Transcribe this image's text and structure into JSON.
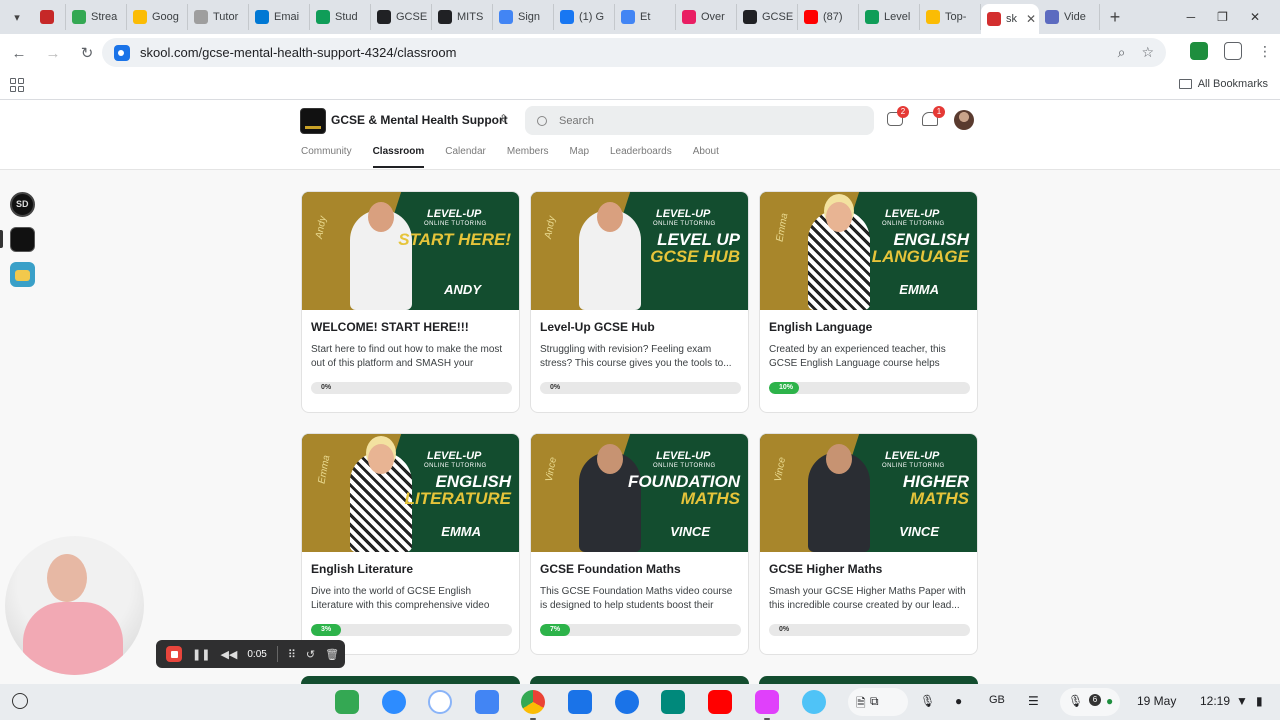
{
  "browser": {
    "tabs": [
      {
        "label": "",
        "color": "#c62828"
      },
      {
        "label": "Strea",
        "color": "#34a853"
      },
      {
        "label": "Goog",
        "color": "#fbbc04"
      },
      {
        "label": "Tutor",
        "color": "#9e9e9e"
      },
      {
        "label": "Emai",
        "color": "#0078d4"
      },
      {
        "label": "Stud",
        "color": "#0f9d58"
      },
      {
        "label": "GCSE",
        "color": "#202124"
      },
      {
        "label": "MITS",
        "color": "#202124"
      },
      {
        "label": "Sign",
        "color": "#4285f4"
      },
      {
        "label": "(1) G",
        "color": "#1877f2"
      },
      {
        "label": "Et",
        "color": "#4285f4"
      },
      {
        "label": "Over",
        "color": "#e91e63"
      },
      {
        "label": "GCSE",
        "color": "#202124"
      },
      {
        "label": "(87)",
        "color": "#ff0000"
      },
      {
        "label": "Level",
        "color": "#0f9d58"
      },
      {
        "label": "Top-",
        "color": "#fbbc04"
      },
      {
        "label": "sk",
        "color": "#d32f2f",
        "active": true
      },
      {
        "label": "Vide",
        "color": "#5c6bc0"
      }
    ],
    "url": "skool.com/gcse-mental-health-support-4324/classroom",
    "all_bookmarks": "All Bookmarks"
  },
  "header": {
    "group_name": "GCSE & Mental Health Support",
    "search_placeholder": "Search",
    "chat_badge": "2",
    "notif_badge": "1",
    "nav": [
      {
        "label": "Community",
        "active": false
      },
      {
        "label": "Classroom",
        "active": true
      },
      {
        "label": "Calendar",
        "active": false
      },
      {
        "label": "Members",
        "active": false
      },
      {
        "label": "Map",
        "active": false
      },
      {
        "label": "Leaderboards",
        "active": false
      },
      {
        "label": "About",
        "active": false
      }
    ]
  },
  "courses": [
    {
      "title": "WELCOME! START HERE!!!",
      "desc": "Start here to find out how to make the most out of this platform and SMASH your GCSE...",
      "progress_label": "0%",
      "progress": 0,
      "thumb": {
        "line1": "START HERE!",
        "line2": "",
        "tutor": "ANDY",
        "person": "white",
        "side": "Andy"
      }
    },
    {
      "title": "Level-Up GCSE Hub",
      "desc": "Struggling with revision? Feeling exam stress? This course gives you the tools to...",
      "progress_label": "0%",
      "progress": 0,
      "thumb": {
        "line1": "LEVEL UP",
        "line2": "GCSE HUB",
        "tutor": "",
        "person": "white",
        "side": "Andy"
      }
    },
    {
      "title": "English Language",
      "desc": "Created by an experienced teacher, this GCSE English Language course helps students...",
      "progress_label": "10%",
      "progress": 10,
      "thumb": {
        "line1": "ENGLISH",
        "line2": "LANGUAGE",
        "tutor": "EMMA",
        "person": "dress",
        "side": "Emma"
      }
    },
    {
      "title": "English Literature",
      "desc": "Dive into the world of GCSE English Literature with this comprehensive video course,...",
      "progress_label": "3%",
      "progress": 3,
      "thumb": {
        "line1": "ENGLISH",
        "line2": "LITERATURE",
        "tutor": "EMMA",
        "person": "dress",
        "side": "Emma"
      }
    },
    {
      "title": "GCSE Foundation Maths",
      "desc": "This GCSE Foundation Maths video course is designed to help students boost their grade...",
      "progress_label": "7%",
      "progress": 7,
      "thumb": {
        "line1": "FOUNDATION",
        "line2": "MATHS",
        "tutor": "VINCE",
        "person": "suit",
        "side": "Vince"
      }
    },
    {
      "title": "GCSE Higher Maths",
      "desc": "Smash your GCSE Higher Maths Paper with this incredible course created by our lead...",
      "progress_label": "0%",
      "progress": 0,
      "thumb": {
        "line1": "HIGHER",
        "line2": "MATHS",
        "tutor": "VINCE",
        "person": "suit",
        "side": "Vince"
      }
    }
  ],
  "thumb_brand": "LEVEL-UP",
  "thumb_brand_sub": "ONLINE TUTORING",
  "recorder": {
    "time": "0:05"
  },
  "shelf": {
    "date": "19 May",
    "time": "12:19",
    "keyboard": "GB",
    "notif_count": "6"
  }
}
